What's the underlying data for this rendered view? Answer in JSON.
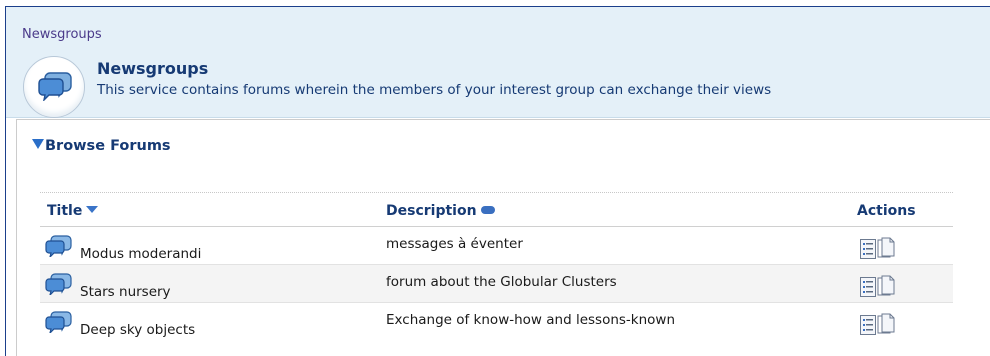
{
  "breadcrumb": "Newsgroups",
  "service": {
    "title": "Newsgroups",
    "description": "This service contains forums wherein the members of your interest group can exchange their views"
  },
  "browse_label": "Browse Forums",
  "table": {
    "columns": {
      "title": "Title",
      "description": "Description",
      "actions": "Actions"
    },
    "rows": [
      {
        "title": "Modus moderandi",
        "description": "messages à éventer"
      },
      {
        "title": "Stars nursery",
        "description": "forum about the Globular Clusters"
      },
      {
        "title": "Deep sky objects",
        "description": "Exchange of know-how and lessons-known"
      }
    ]
  },
  "icons": {
    "service": "chat-bubbles-icon",
    "row": "forum-bubbles-icon",
    "action_list": "list-view-icon",
    "action_copy": "copy-pages-icon"
  },
  "colors": {
    "header_bg": "#e4f0f8",
    "heading_text": "#163a74",
    "breadcrumb_text": "#4a3a8a",
    "accent_blue": "#3a74c8",
    "alt_row_bg": "#f4f4f4"
  }
}
